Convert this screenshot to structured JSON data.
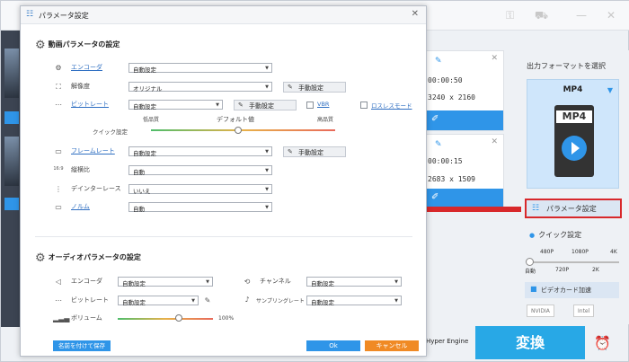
{
  "app": {
    "hyper_engine": "Hyper Engine",
    "convert_label": "変換",
    "files": [
      {
        "duration": "00:00:50",
        "resolution": "3240 x 2160"
      },
      {
        "duration": "00:00:15",
        "resolution": "2683 x 1509"
      }
    ],
    "right_panel": {
      "output_format_label": "出力フォーマットを選択",
      "format_name": "MP4",
      "format_file_tag": "MP4",
      "param_button": "パラメータ設定",
      "quick_label": "クイック設定",
      "quick_top": [
        "480P",
        "1080P",
        "4K"
      ],
      "quick_bottom": [
        "自動",
        "720P",
        "2K"
      ],
      "gpu_label": "ビデオカード加速",
      "chips": [
        "NVIDIA",
        "Intel"
      ]
    }
  },
  "modal": {
    "title": "パラメータ設定",
    "video_section": "動画パラメータの設定",
    "encoder_label": "エンコーダ",
    "encoder_value": "自動設定",
    "resolution_label": "解像度",
    "resolution_value": "オリジナル",
    "manual_label": "手動設定",
    "bitrate_label": "ビットレート",
    "bitrate_value": "自動設定",
    "vbr_label": "VBR",
    "lossless_label": "ロスレスモード",
    "quick_setting_label": "クイック設定",
    "low_quality": "低品質",
    "default_value": "デフォルト値",
    "high_quality": "高品質",
    "framerate_label": "フレームレート",
    "framerate_value": "自動設定",
    "aspect_label": "縦横比",
    "aspect_value": "自動",
    "deinterlace_label": "デインターレース",
    "deinterlace_value": "いいえ",
    "norm_label": "ノルム",
    "norm_value": "自動",
    "audio_section": "オーディオパラメータの設定",
    "a_encoder_label": "エンコーダ",
    "a_encoder_value": "自動設定",
    "channel_label": "チャンネル",
    "channel_value": "自動設定",
    "a_bitrate_label": "ビットレート",
    "a_bitrate_value": "自動設定",
    "sampling_label": "サンプリングレート",
    "sampling_value": "自動設定",
    "volume_label": "ボリューム",
    "volume_value": "100%",
    "volume_level": 100,
    "save_name_button": "名前を付けて保存",
    "ok_button": "Ok",
    "cancel_button": "キャンセル"
  }
}
